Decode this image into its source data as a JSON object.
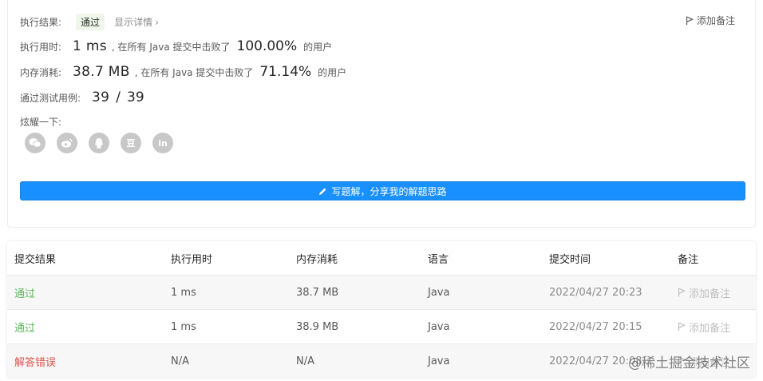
{
  "result": {
    "status_label": "执行结果:",
    "status_value": "通过",
    "detail_link": "显示详情",
    "detail_chevron": "›",
    "add_note": "添加备注",
    "runtime_label": "执行用时:",
    "runtime_value": "1 ms",
    "runtime_mid": ", 在所有 Java 提交中击败了",
    "runtime_pct": "100.00%",
    "runtime_tail": "的用户",
    "memory_label": "内存消耗:",
    "memory_value": "38.7 MB",
    "memory_mid": ", 在所有 Java 提交中击败了",
    "memory_pct": "71.14%",
    "memory_tail": "的用户",
    "cases_label": "通过测试用例:",
    "cases_passed": "39",
    "cases_sep": "/",
    "cases_total": "39",
    "share_label": "炫耀一下:",
    "share_icons": [
      "wechat-icon",
      "weibo-icon",
      "qq-icon",
      "douban-icon",
      "linkedin-icon"
    ],
    "share_glyphs": [
      "",
      "",
      "",
      "豆",
      "in"
    ],
    "write_button": "写题解，分享我的解题思路"
  },
  "table": {
    "headers": [
      "提交结果",
      "执行用时",
      "内存消耗",
      "语言",
      "提交时间",
      "备注"
    ],
    "rows": [
      {
        "result": "通过",
        "runtime": "1 ms",
        "memory": "38.7 MB",
        "language": "Java",
        "time": "2022/04/27 20:23",
        "note": "添加备注"
      },
      {
        "result": "通过",
        "runtime": "1 ms",
        "memory": "38.9 MB",
        "language": "Java",
        "time": "2022/04/27 20:15",
        "note": "添加备注"
      },
      {
        "result": "解答错误",
        "runtime": "N/A",
        "memory": "N/A",
        "language": "Java",
        "time": "2022/04/27 20:08",
        "note": "添加备注"
      }
    ]
  },
  "colors": {
    "accent": "#1890ff",
    "pass": "#5cb85c",
    "fail": "#e0534f"
  },
  "watermark": "@稀土掘金技术社区"
}
